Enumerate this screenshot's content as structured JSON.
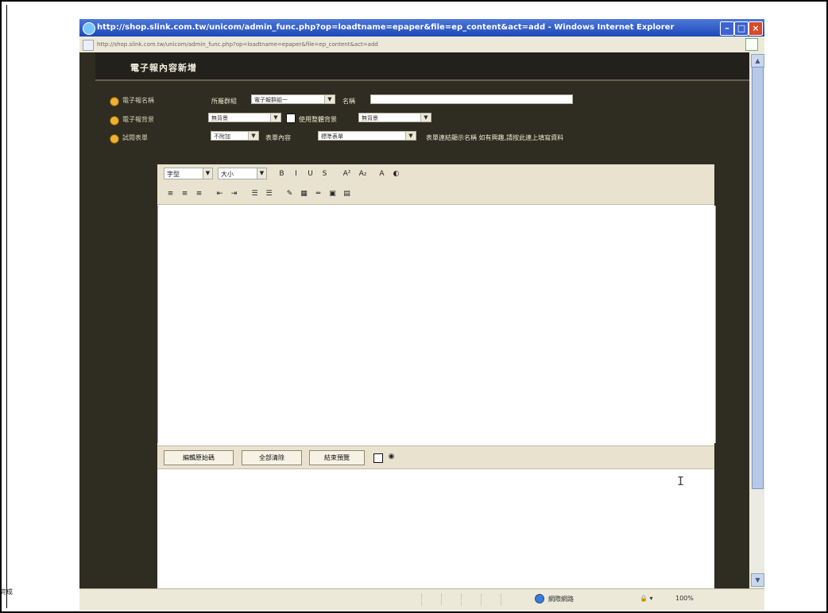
{
  "window": {
    "title": "http://shop.slink.com.tw/unicom/admin_func.php?op=loadtname=epaper&file=ep_content&act=add - Windows Internet Explorer",
    "address": "http://shop.slink.com.tw/unicom/admin_func.php?op=loadtname=epaper&file=ep_content&act=add"
  },
  "page": {
    "title": "電子報內容新增",
    "rows": [
      {
        "label": "電子報名稱"
      },
      {
        "label": "電子報背景"
      },
      {
        "label": "試閱表單"
      }
    ]
  },
  "form": {
    "group_label": "所屬群組",
    "group_value": "電子報群組一",
    "name_label": "名稱",
    "background_value": "無背景",
    "use_bg_label": "使用整體背景",
    "bg2_value": "無背景",
    "attach_value": "不附加",
    "content_label": "表單內容",
    "content_value": "標準表單",
    "hint": "表單連結顯示名稱 如有興趣,請按此連上填寫資料"
  },
  "toolbar": {
    "font_label": "字型",
    "size_label": "大小",
    "row1_icons": [
      "bold-icon",
      "italic-icon",
      "underline-icon",
      "strikethrough-icon",
      "superscript-icon",
      "subscript-icon",
      "font-color-icon",
      "highlight-icon"
    ],
    "row2_icons": [
      "align-left-icon",
      "align-center-icon",
      "align-right-icon",
      "outdent-icon",
      "indent-icon",
      "ordered-list-icon",
      "unordered-list-icon",
      "pen-icon",
      "table-icon",
      "horizontal-rule-icon",
      "image-icon",
      "chart-icon"
    ]
  },
  "bottombar": {
    "edit_source_label": "編輯原始碼",
    "clear_all_label": "全部清除",
    "end_preview_label": "結束預覽"
  },
  "statusbar": {
    "left": "完成",
    "zone": "網際網路",
    "zoom": "100%"
  }
}
